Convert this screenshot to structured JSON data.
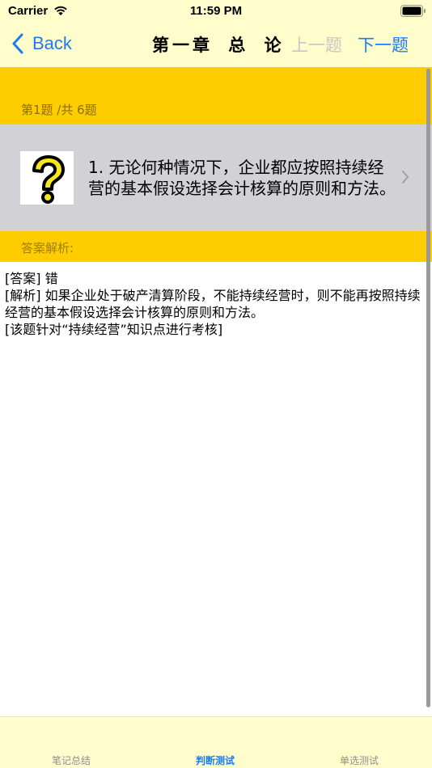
{
  "status_bar": {
    "carrier": "Carrier",
    "time": "11:59 PM"
  },
  "nav": {
    "back_label": "Back",
    "title": "第一章 总 论",
    "prev_label": "上一题",
    "next_label": "下一题"
  },
  "counter": "第1题 /共 6题",
  "question": {
    "icon": "question-mark-icon",
    "text": "1.   无论何种情况下，企业都应按照持续经营的基本假设选择会计核算的原则和方法。"
  },
  "analysis": {
    "title": "答案解析:",
    "body": "[答案] 错\n[解析] 如果企业处于破产清算阶段，不能持续经营时，则不能再按照持续经营的基本假设选择会计核算的原则和方法。\n[该题针对“持续经营”知识点进行考核]"
  },
  "tabs": [
    {
      "label": "笔记总结",
      "active": false
    },
    {
      "label": "判断测试",
      "active": true
    },
    {
      "label": "单选测试",
      "active": false
    }
  ],
  "colors": {
    "accent": "#1a7cf5",
    "band": "#ffcc00",
    "bar_background": "#fffdcc",
    "question_row": "#d1d1d6"
  }
}
